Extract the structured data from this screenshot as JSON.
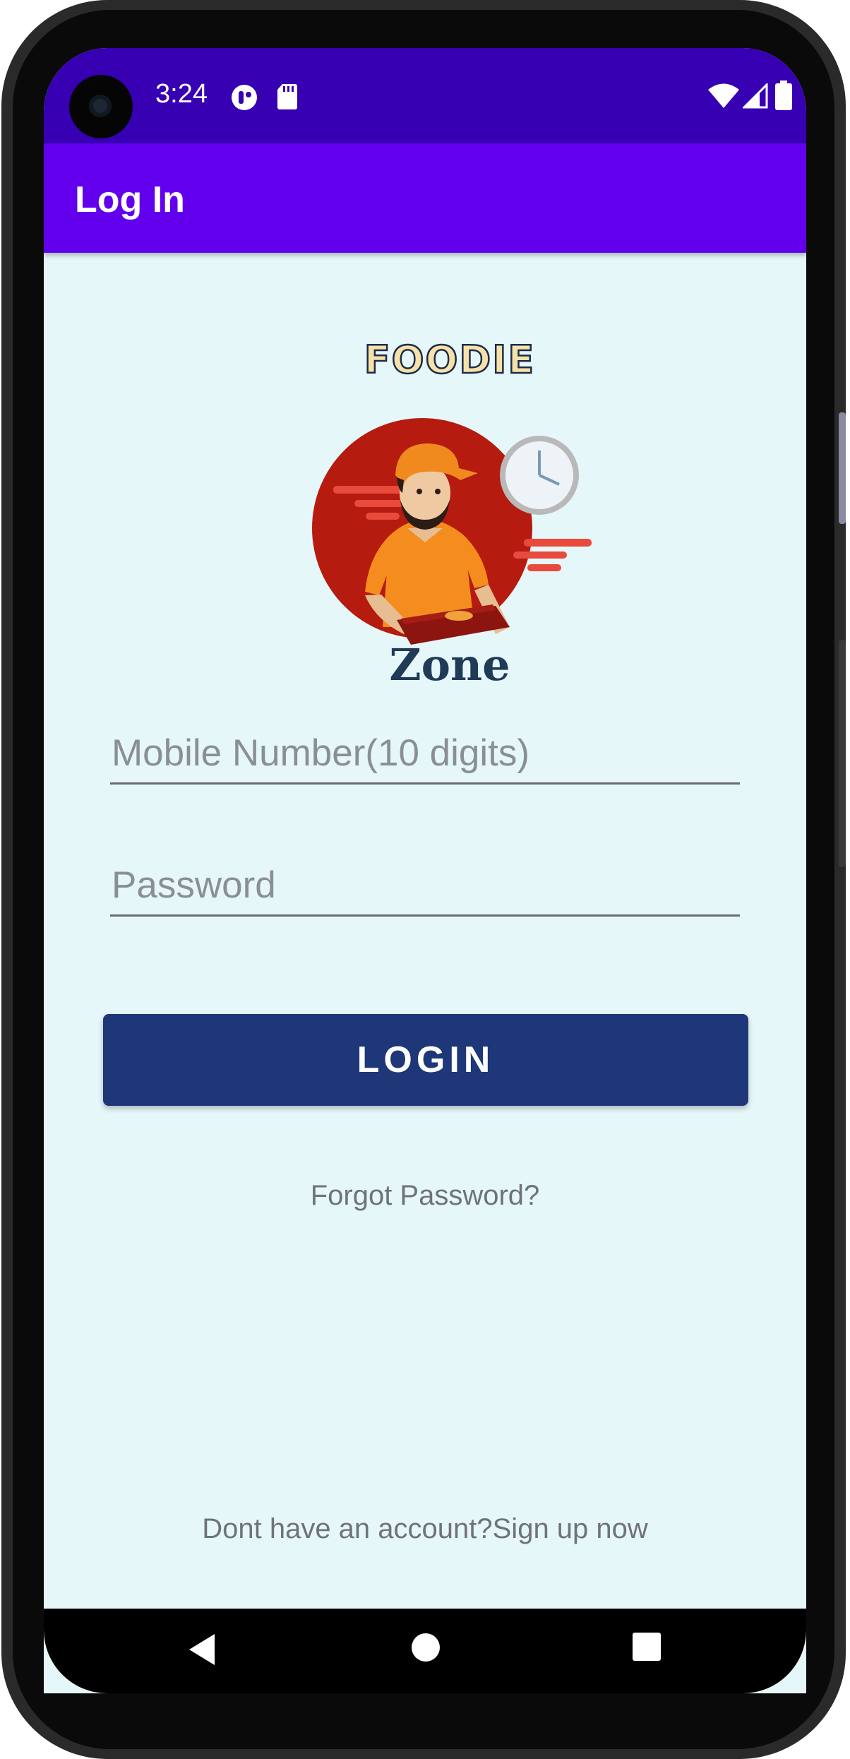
{
  "status_bar": {
    "time": "3:24",
    "left_icons": [
      "notification-app-icon",
      "sd-card-icon"
    ],
    "right_icons": [
      "wifi-icon",
      "cell-signal-icon",
      "battery-icon"
    ]
  },
  "app_bar": {
    "title": "Log In"
  },
  "logo": {
    "top_text": "FOODIE",
    "bottom_text": "Zone"
  },
  "form": {
    "mobile_placeholder": "Mobile Number(10 digits)",
    "password_placeholder": "Password",
    "login_label": "LOGIN",
    "forgot_label": "Forgot Password?",
    "signup_label": "Dont have an account?Sign up now"
  },
  "nav_bar": {
    "icons": [
      "back-icon",
      "home-icon",
      "recents-icon"
    ]
  },
  "colors": {
    "status_bar": "#3700b3",
    "app_bar": "#6200ee",
    "background": "#e6f7fa",
    "login_button": "#1d3778"
  }
}
